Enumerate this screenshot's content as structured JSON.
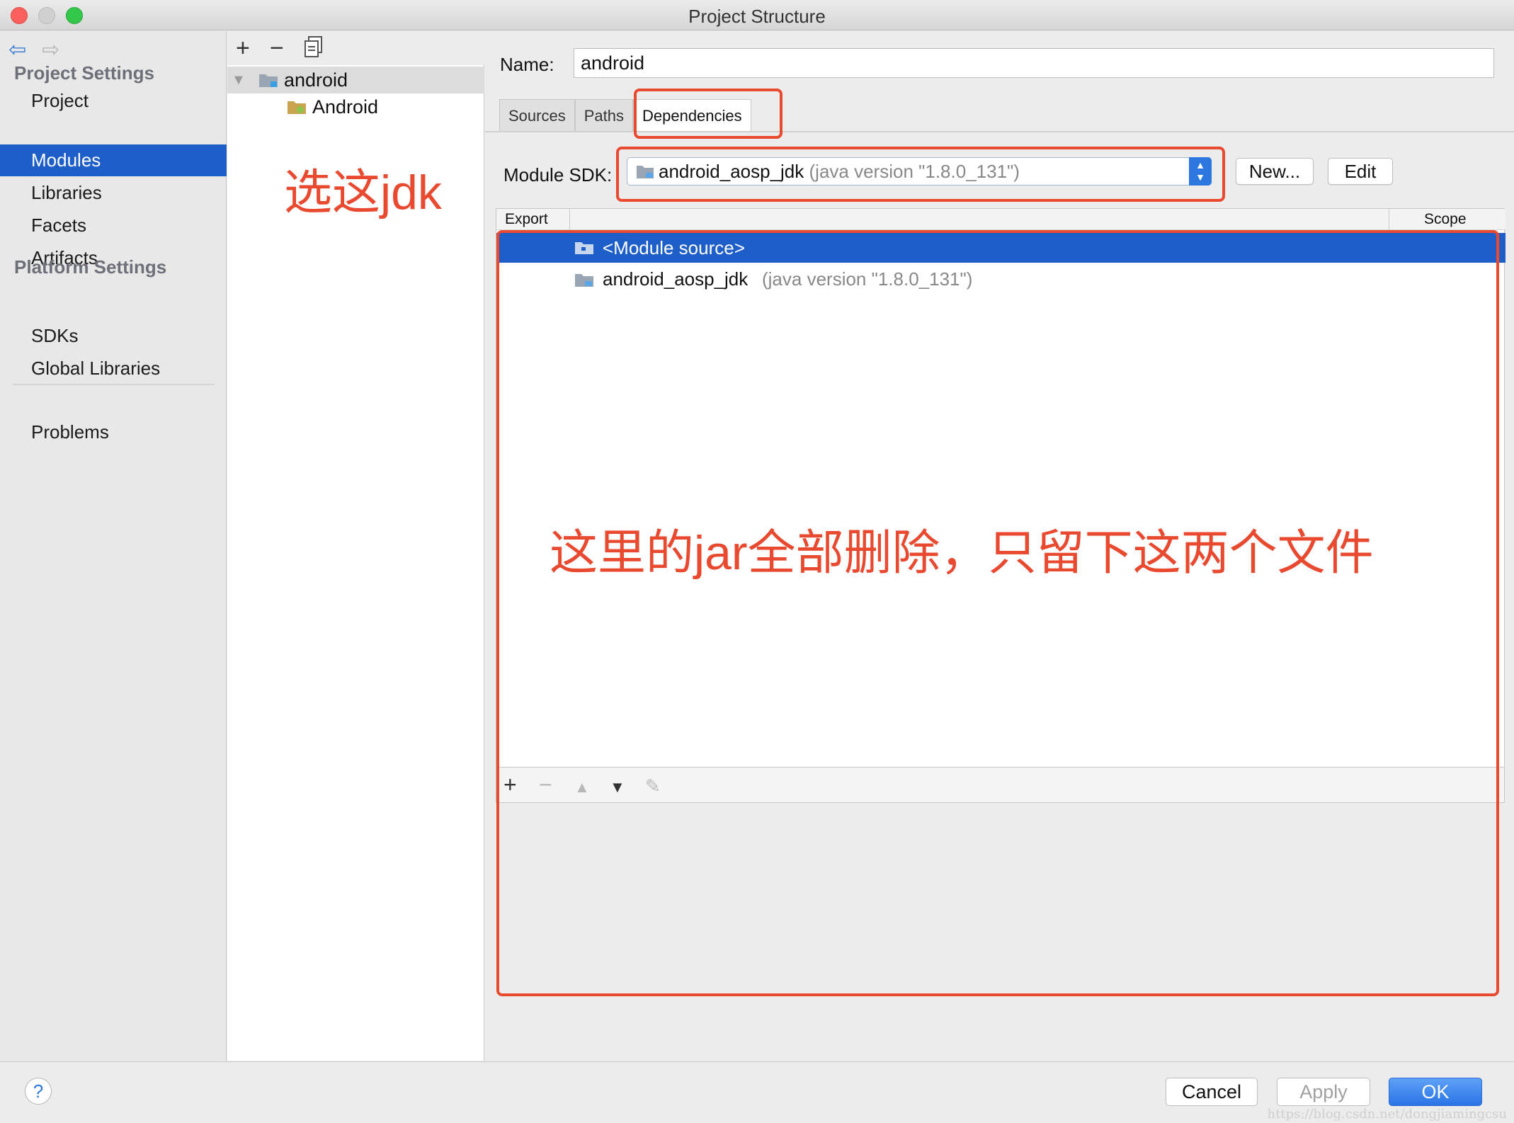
{
  "window": {
    "title": "Project Structure"
  },
  "nav": {
    "project_settings_heading": "Project Settings",
    "project_items": [
      "Project",
      "Modules",
      "Libraries",
      "Facets",
      "Artifacts"
    ],
    "platform_settings_heading": "Platform Settings",
    "platform_items": [
      "SDKs",
      "Global Libraries"
    ],
    "problems": "Problems",
    "selected": "Modules"
  },
  "tree": {
    "toolbar": {
      "add": "+",
      "remove": "−"
    },
    "root": "android",
    "child": "Android"
  },
  "annotations": {
    "choose_jdk": "选这jdk",
    "delete_jars": "这里的jar全部删除，只留下这两个文件"
  },
  "module": {
    "name_label": "Name:",
    "name_value": "android",
    "tabs": [
      "Sources",
      "Paths",
      "Dependencies"
    ],
    "active_tab": "Dependencies",
    "sdk_label": "Module SDK:",
    "sdk_name": "android_aosp_jdk",
    "sdk_version": "(java version \"1.8.0_131\")",
    "new_button": "New...",
    "edit_button": "Edit"
  },
  "dependencies": {
    "columns": {
      "export": "Export",
      "scope": "Scope"
    },
    "rows": [
      {
        "name": "<Module source>",
        "detail": ""
      },
      {
        "name": "android_aosp_jdk",
        "detail": "(java version \"1.8.0_131\")"
      }
    ],
    "toolbar": {
      "add": "+",
      "remove": "−",
      "up": "▲",
      "down": "▼",
      "edit": "✎"
    }
  },
  "footer": {
    "help": "?",
    "cancel": "Cancel",
    "apply": "Apply",
    "ok": "OK",
    "watermark": "https://blog.csdn.net/dongjiamingcsu"
  },
  "colors": {
    "selection": "#1e5ec8",
    "annotation": "#e8492f",
    "primary_button": "#2a74e6"
  }
}
